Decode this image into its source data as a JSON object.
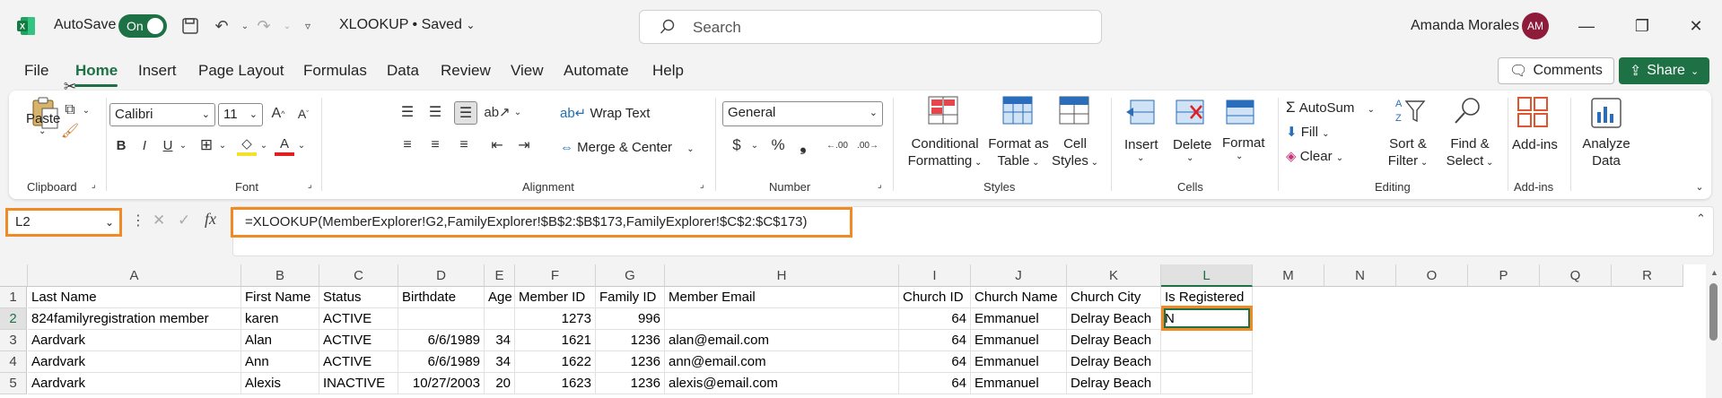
{
  "titlebar": {
    "autosave_label": "AutoSave",
    "autosave_state": "On",
    "doc_title": "XLOOKUP • Saved",
    "search_placeholder": "Search",
    "user_name": "Amanda Morales",
    "user_initials": "AM"
  },
  "menu": {
    "items": [
      "File",
      "Home",
      "Insert",
      "Page Layout",
      "Formulas",
      "Data",
      "Review",
      "View",
      "Automate",
      "Help"
    ],
    "active": "Home",
    "comments_label": "Comments",
    "share_label": "Share"
  },
  "ribbon": {
    "clipboard": {
      "paste_label": "Paste",
      "group_label": "Clipboard"
    },
    "font": {
      "font_name": "Calibri",
      "font_size": "11",
      "group_label": "Font"
    },
    "alignment": {
      "wrap_text": "Wrap Text",
      "merge_center": "Merge & Center",
      "group_label": "Alignment"
    },
    "number": {
      "format": "General",
      "group_label": "Number"
    },
    "styles": {
      "conditional_formatting": [
        "Conditional",
        "Formatting"
      ],
      "format_as_table": [
        "Format as",
        "Table"
      ],
      "cell_styles": [
        "Cell",
        "Styles"
      ],
      "group_label": "Styles"
    },
    "cells": {
      "insert": "Insert",
      "delete": "Delete",
      "format": "Format",
      "group_label": "Cells"
    },
    "editing": {
      "autosum": "AutoSum",
      "fill": "Fill",
      "clear": "Clear",
      "sort_filter": [
        "Sort &",
        "Filter"
      ],
      "find_select": [
        "Find &",
        "Select"
      ],
      "group_label": "Editing"
    },
    "addins": {
      "addins": "Add-ins",
      "group_label": "Add-ins"
    },
    "analyze": {
      "label": [
        "Analyze",
        "Data"
      ]
    }
  },
  "formula_bar": {
    "name_box": "L2",
    "formula": "=XLOOKUP(MemberExplorer!G2,FamilyExplorer!$B$2:$B$173,FamilyExplorer!$C$2:$C$173)"
  },
  "sheet": {
    "columns": [
      "A",
      "B",
      "C",
      "D",
      "E",
      "F",
      "G",
      "H",
      "I",
      "J",
      "K",
      "L",
      "M",
      "N",
      "O",
      "P",
      "Q",
      "R"
    ],
    "row_numbers": [
      "1",
      "2",
      "3",
      "4",
      "5"
    ],
    "rows": [
      [
        "Last Name",
        "First Name",
        "Status",
        "Birthdate",
        "Age",
        "Member ID",
        "Family ID",
        "Member Email",
        "Church ID",
        "Church Name",
        "Church City",
        "Is Registered"
      ],
      [
        "824familyregistration member",
        "karen",
        "ACTIVE",
        "",
        "",
        "1273",
        "996",
        "",
        "64",
        "Emmanuel",
        "Delray Beach",
        "N"
      ],
      [
        "Aardvark",
        "Alan",
        "ACTIVE",
        "6/6/1989",
        "34",
        "1621",
        "1236",
        "alan@email.com",
        "64",
        "Emmanuel",
        "Delray Beach",
        ""
      ],
      [
        "Aardvark",
        "Ann",
        "ACTIVE",
        "6/6/1989",
        "34",
        "1622",
        "1236",
        "ann@email.com",
        "64",
        "Emmanuel",
        "Delray Beach",
        ""
      ],
      [
        "Aardvark",
        "Alexis",
        "INACTIVE",
        "10/27/2003",
        "20",
        "1623",
        "1236",
        "alexis@email.com",
        "64",
        "Emmanuel",
        "Delray Beach",
        ""
      ]
    ],
    "selected_cell": "L2"
  },
  "colors": {
    "accent": "#1e7145",
    "highlight": "#f08a24"
  }
}
